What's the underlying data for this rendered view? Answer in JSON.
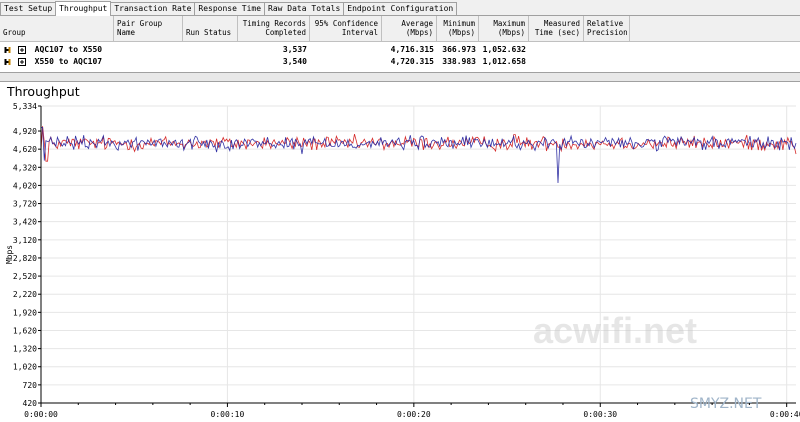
{
  "tabs": [
    {
      "label": "Test Setup"
    },
    {
      "label": "Throughput"
    },
    {
      "label": "Transaction Rate"
    },
    {
      "label": "Response Time"
    },
    {
      "label": "Raw Data Totals"
    },
    {
      "label": "Endpoint Configuration"
    }
  ],
  "table": {
    "headers": {
      "group": "Group",
      "pair_group_name_1": "Pair Group",
      "pair_group_name_2": "Name",
      "run_status": "Run Status",
      "timing_records_1": "Timing Records",
      "timing_records_2": "Completed",
      "confidence_1": "95% Confidence",
      "confidence_2": "Interval",
      "average_1": "Average",
      "average_2": "(Mbps)",
      "minimum_1": "Minimum",
      "minimum_2": "(Mbps)",
      "maximum_1": "Maximum",
      "maximum_2": "(Mbps)",
      "measured_1": "Measured",
      "measured_2": "Time (sec)",
      "relative_1": "Relative",
      "relative_2": "Precision"
    },
    "rows": [
      {
        "group": "AQC107 to X550",
        "pair_group_name": "",
        "run_status": "",
        "timing_records": "3,537",
        "confidence": "",
        "average": "4,716.315",
        "minimum": "366.973",
        "maximum": "1,052.632",
        "measured": "",
        "relative": ""
      },
      {
        "group": "X550 to AQC107",
        "pair_group_name": "",
        "run_status": "",
        "timing_records": "3,540",
        "confidence": "",
        "average": "4,720.315",
        "minimum": "338.983",
        "maximum": "1,012.658",
        "measured": "",
        "relative": ""
      }
    ]
  },
  "chart_data": {
    "type": "line",
    "title": "Throughput",
    "ylabel": "Mbps",
    "xlabel": "",
    "ylim": [
      420,
      5334
    ],
    "yticks": [
      "5,334",
      "4,920",
      "4,620",
      "4,320",
      "4,020",
      "3,720",
      "3,420",
      "3,120",
      "2,820",
      "2,520",
      "2,220",
      "1,920",
      "1,620",
      "1,320",
      "1,020",
      "720",
      "420"
    ],
    "xticks": [
      "0:00:00",
      "0:00:10",
      "0:00:20",
      "0:00:30",
      "0:00:40"
    ],
    "x_range_seconds": [
      0,
      40.5
    ],
    "series": [
      {
        "name": "AQC107 to X550",
        "color": "#d42020",
        "mean": 4716,
        "noise": 95,
        "spikes": [
          [
            0.1,
            5000
          ],
          [
            0.3,
            4420
          ],
          [
            25.4,
            4860
          ],
          [
            40.5,
            4540
          ]
        ]
      },
      {
        "name": "X550 to AQC107",
        "color": "#2828a0",
        "mean": 4720,
        "noise": 90,
        "spikes": [
          [
            0.05,
            4980
          ],
          [
            0.2,
            4430
          ],
          [
            27.7,
            4060
          ],
          [
            27.9,
            4620
          ],
          [
            14.0,
            4540
          ]
        ]
      }
    ],
    "grid": true,
    "legend": "none"
  },
  "watermarks": {
    "main": "acwifi.net",
    "corner": "SMYZ.NET"
  },
  "colors": {
    "chart_background": "#ffffff",
    "gridline": "#e6e6e6",
    "series_1": "#d42020",
    "series_2": "#2828a0"
  }
}
